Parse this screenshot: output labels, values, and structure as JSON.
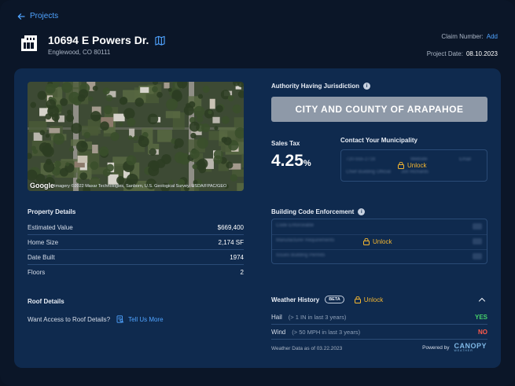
{
  "nav": {
    "back_label": "Projects"
  },
  "header": {
    "title": "10694 E Powers Dr.",
    "subtitle": "Englewood, CO 80111",
    "claim_label": "Claim Number:",
    "claim_action": "Add",
    "date_label": "Project Date:",
    "date_value": "08.10.2023"
  },
  "map": {
    "provider": "Google",
    "attribution": "Imagery ©2022 Maxar Technologies, Sanborn, U.S. Geological Survey, USDA/FPAC/GEO"
  },
  "ahj": {
    "title": "Authority Having Jurisdiction",
    "value": "CITY AND COUNTY OF ARAPAHOE"
  },
  "sales_tax": {
    "label": "Sales Tax",
    "value": "4.25",
    "unit": "%"
  },
  "contact": {
    "title": "Contact Your Municipality",
    "blurred_1": "720-555-2716",
    "blurred_2": "Website",
    "blurred_3": "Email",
    "blurred_4": "Chief Building Official",
    "blurred_5": "Jon Richards",
    "unlock_label": "Unlock"
  },
  "property": {
    "title": "Property Details",
    "rows": [
      {
        "label": "Estimated Value",
        "value": "$669,400"
      },
      {
        "label": "Home Size",
        "value": "2,174 SF"
      },
      {
        "label": "Date Built",
        "value": "1974"
      },
      {
        "label": "Floors",
        "value": "2"
      }
    ]
  },
  "code_enforcement": {
    "title": "Building Code Enforcement",
    "rows": [
      "Code Enforceable",
      "Manufacturer Requirements",
      "Issues Building Permits"
    ],
    "unlock_label": "Unlock"
  },
  "roof": {
    "title": "Roof Details",
    "question": "Want Access to Roof Details?",
    "cta": "Tell Us More"
  },
  "weather": {
    "title": "Weather History",
    "badge": "BETA",
    "unlock_label": "Unlock",
    "rows": [
      {
        "label": "Hail",
        "criteria": "(> 1 IN in last 3 years)",
        "result": "YES"
      },
      {
        "label": "Wind",
        "criteria": "(> 50 MPH in last 3 years)",
        "result": "NO"
      }
    ],
    "as_of": "Weather Data as of 03.22.2023",
    "powered_by": "Powered by",
    "brand": "CANOPY",
    "brand_sub": "WEATHER"
  },
  "colors": {
    "accent": "#4fa3ff",
    "unlock": "#f5b731",
    "yes": "#46d36b",
    "no": "#ff5a4a",
    "card": "#0f2a4e"
  },
  "icons": [
    "back-arrow-icon",
    "building-logo-icon",
    "map-icon",
    "info-icon",
    "lock-icon",
    "document-search-icon",
    "chevron-up-icon"
  ]
}
